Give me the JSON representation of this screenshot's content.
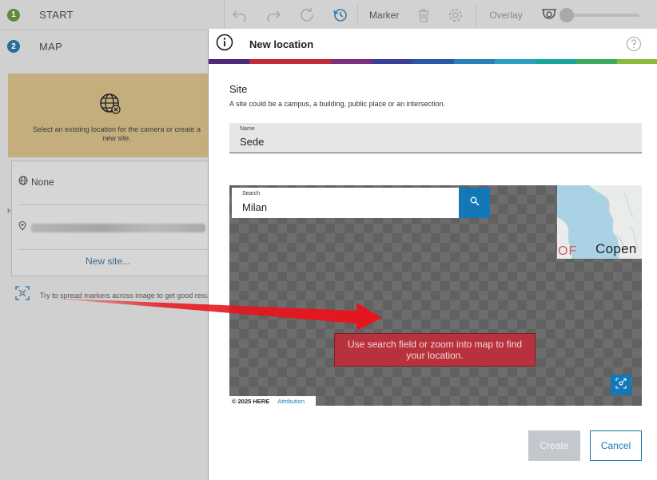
{
  "steps": [
    {
      "number": "1",
      "label": "START"
    },
    {
      "number": "2",
      "label": "MAP"
    }
  ],
  "toolbar": {
    "marker_label": "Marker",
    "overlay_label": "Overlay",
    "overlay_level": 0
  },
  "sidebar": {
    "location_card_text": "Select an existing location for the camera or create a new site.",
    "none_option": "None",
    "new_site_link": "New site...",
    "section_letter": "H",
    "hint": "Try to spread markers across image to get good results."
  },
  "dialog": {
    "title": "New location",
    "stripe_colors": [
      "#4d2a7a",
      "#c02b36",
      "#c02b36",
      "#7a2f7f",
      "#3a3f97",
      "#2a58a6",
      "#2a7fb8",
      "#2e9fc4",
      "#1aa69a",
      "#3aab5e",
      "#8ab93c"
    ],
    "site_heading": "Site",
    "site_description": "A site could be a campus, a building, public place or an intersection.",
    "name_field": {
      "label": "Name",
      "value": "Sede"
    },
    "map": {
      "search_label": "Search",
      "search_value": "Milan",
      "minimap_city": "Copen",
      "minimap_region": "OF",
      "tip": "Use search field or zoom into map to find your location.",
      "copyright": "© 2025 HERE",
      "attribution": "Attribution"
    },
    "create_label": "Create",
    "cancel_label": "Cancel"
  },
  "colors": {
    "accent": "#1378b8",
    "tip_background": "#b8323d",
    "annotation_arrow": "#e8141c"
  },
  "icons": [
    "undo-icon",
    "redo-icon",
    "reset-icon",
    "history-icon",
    "trash-icon",
    "gear-icon",
    "camera-icon",
    "globe-x-icon",
    "globe-icon",
    "pin-icon",
    "spread-markers-icon",
    "info-icon",
    "help-icon",
    "search-icon",
    "locate-icon"
  ]
}
